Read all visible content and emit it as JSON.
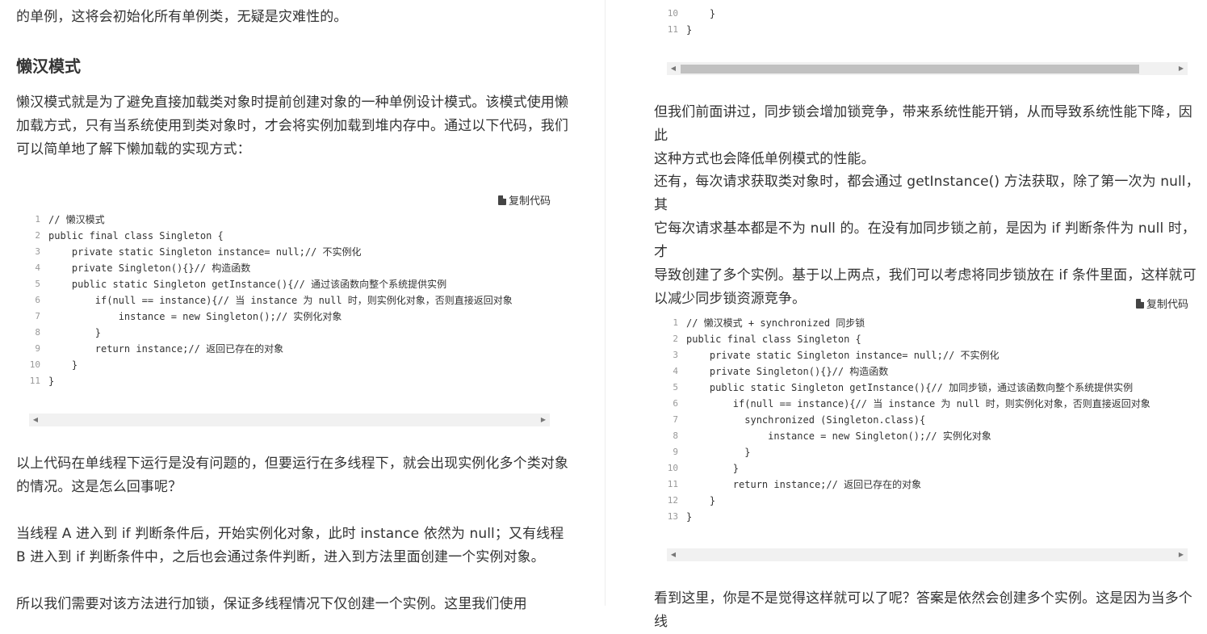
{
  "left": {
    "p_top": "的单例，这将会初始化所有单例类，无疑是灾难性的。",
    "heading": "懒汉模式",
    "p_intro_lines": [
      "懒汉模式就是为了避免直接加载类对象时提前创建对象的一种单例设计模式。该模式使用懒",
      "加载方式，只有当系统使用到类对象时，才会将实例加载到堆内存中。通过以下代码，我们",
      "可以简单地了解下懒加载的实现方式："
    ],
    "copy_label": "复制代码",
    "code": [
      {
        "n": "1",
        "t": "// 懒汉模式"
      },
      {
        "n": "2",
        "t": "public final class Singleton {"
      },
      {
        "n": "3",
        "t": "    private static Singleton instance= null;// 不实例化"
      },
      {
        "n": "4",
        "t": "    private Singleton(){}// 构造函数"
      },
      {
        "n": "5",
        "t": "    public static Singleton getInstance(){// 通过该函数向整个系统提供实例"
      },
      {
        "n": "6",
        "t": "        if(null == instance){// 当 instance 为 null 时，则实例化对象，否则直接返回对象"
      },
      {
        "n": "7",
        "t": "            instance = new Singleton();// 实例化对象"
      },
      {
        "n": "8",
        "t": "        }"
      },
      {
        "n": "9",
        "t": "        return instance;// 返回已存在的对象"
      },
      {
        "n": "10",
        "t": "    }"
      },
      {
        "n": "11",
        "t": "}"
      }
    ],
    "p_after_lines": [
      "以上代码在单线程下运行是没有问题的，但要运行在多线程下，就会出现实例化多个类对象",
      "的情况。这是怎么回事呢？"
    ],
    "p_thread_lines": [
      "当线程 A 进入到 if 判断条件后，开始实例化对象，此时 instance 依然为 null；又有线程",
      "B 进入到 if 判断条件中，之后也会通过条件判断，进入到方法里面创建一个实例对象。"
    ],
    "p_bottom": "所以我们需要对该方法进行加锁，保证多线程情况下仅创建一个实例。这里我们使用"
  },
  "right": {
    "code_top": [
      {
        "n": "10",
        "t": "    }"
      },
      {
        "n": "11",
        "t": "}"
      }
    ],
    "p1_lines": [
      "但我们前面讲过，同步锁会增加锁竞争，带来系统性能开销，从而导致系统性能下降，因此",
      "这种方式也会降低单例模式的性能。"
    ],
    "p2_lines": [
      "还有，每次请求获取类对象时，都会通过 getInstance() 方法获取，除了第一次为 null，其",
      "它每次请求基本都是不为 null 的。在没有加同步锁之前，是因为 if 判断条件为 null 时，才",
      "导致创建了多个实例。基于以上两点，我们可以考虑将同步锁放在 if 条件里面，这样就可",
      "以减少同步锁资源竞争。"
    ],
    "copy_label": "复制代码",
    "code": [
      {
        "n": "1",
        "t": "// 懒汉模式 + synchronized 同步锁"
      },
      {
        "n": "2",
        "t": "public final class Singleton {"
      },
      {
        "n": "3",
        "t": "    private static Singleton instance= null;// 不实例化"
      },
      {
        "n": "4",
        "t": "    private Singleton(){}// 构造函数"
      },
      {
        "n": "5",
        "t": "    public static Singleton getInstance(){// 加同步锁，通过该函数向整个系统提供实例"
      },
      {
        "n": "6",
        "t": "        if(null == instance){// 当 instance 为 null 时，则实例化对象，否则直接返回对象"
      },
      {
        "n": "7",
        "t": "          synchronized (Singleton.class){"
      },
      {
        "n": "8",
        "t": "              instance = new Singleton();// 实例化对象"
      },
      {
        "n": "9",
        "t": "          }"
      },
      {
        "n": "10",
        "t": "        }"
      },
      {
        "n": "11",
        "t": "        return instance;// 返回已存在的对象"
      },
      {
        "n": "12",
        "t": "    }"
      },
      {
        "n": "13",
        "t": "}"
      }
    ],
    "p_bottom": "看到这里，你是不是觉得这样就可以了呢？答案是依然会创建多个实例。这是因为当多个线"
  },
  "icons": {
    "copy": "copy-icon",
    "scroll_left": "scroll-left-icon",
    "scroll_right": "scroll-right-icon"
  }
}
